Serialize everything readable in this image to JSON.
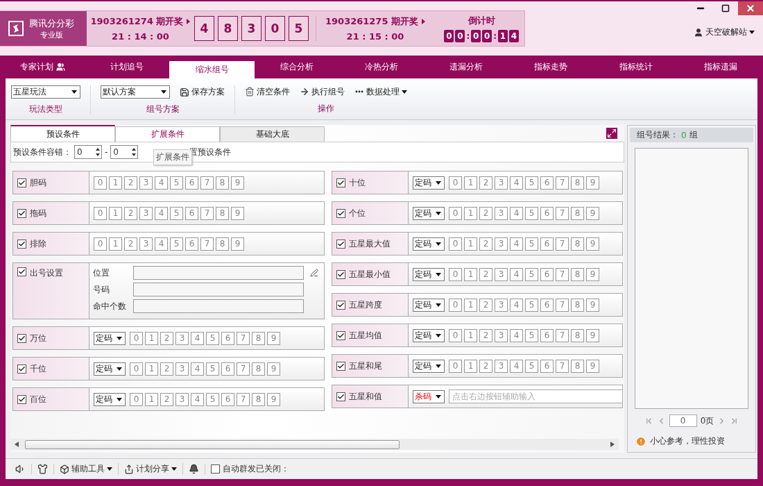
{
  "header": {
    "logo": {
      "name": "腾讯分分彩",
      "edition": "专业版"
    },
    "current": {
      "issue": "1903261274 期开奖",
      "time": "21 : 14 : 00"
    },
    "balls": [
      "4",
      "8",
      "3",
      "0",
      "5"
    ],
    "next": {
      "issue": "1903261275 期开奖",
      "time": "21 : 15 : 00"
    },
    "countdown": {
      "label": "倒计时",
      "groups": [
        [
          "0",
          "0"
        ],
        [
          "0",
          "0"
        ],
        [
          "1",
          "4"
        ]
      ],
      "separator": ":"
    },
    "user": "天空破解站"
  },
  "nav": [
    {
      "label": "专家计划",
      "kind": "icon",
      "selected": false
    },
    {
      "label": "计划追号",
      "kind": "plain",
      "selected": false
    },
    {
      "label": "缩水组号",
      "kind": "plain",
      "selected": true
    },
    {
      "label": "综合分析",
      "kind": "plain",
      "selected": false
    },
    {
      "label": "冷热分析",
      "kind": "plain",
      "selected": false
    },
    {
      "label": "遗漏分析",
      "kind": "plain",
      "selected": false
    },
    {
      "label": "指标走势",
      "kind": "plain",
      "selected": false
    },
    {
      "label": "指标统计",
      "kind": "plain",
      "selected": false
    },
    {
      "label": "指标遗漏",
      "kind": "plain",
      "selected": false
    }
  ],
  "toolbar": [
    {
      "label": "玩法类型",
      "items": [
        {
          "kind": "select",
          "label": "五星玩法"
        }
      ]
    },
    {
      "label": "组号方案",
      "items": [
        {
          "kind": "select",
          "label": "默认方案"
        },
        {
          "kind": "save",
          "label": "保存方案"
        }
      ]
    },
    {
      "label": "操作",
      "items": [
        {
          "kind": "clear",
          "label": "清空条件"
        },
        {
          "kind": "run",
          "label": "执行组号"
        },
        {
          "kind": "menu",
          "label": "数据处理"
        }
      ]
    }
  ],
  "subtabs": [
    {
      "label": "预设条件",
      "selected": true,
      "hovered": false
    },
    {
      "label": "扩展条件",
      "selected": false,
      "hovered": true
    },
    {
      "label": "基础大底",
      "selected": false,
      "hovered": false
    }
  ],
  "tolerance": {
    "label": "预设条件容错：",
    "from": "0",
    "separator": "-",
    "to": "0",
    "tooltip": "扩展条件",
    "reset": "置预设条件"
  },
  "left_conditions": [
    {
      "kind": "digits",
      "label": "胆码",
      "checked": true,
      "digits": [
        {
          "d": "0",
          "selected": false
        },
        {
          "d": "1",
          "selected": false
        },
        {
          "d": "2",
          "selected": false
        },
        {
          "d": "3",
          "selected": false
        },
        {
          "d": "4",
          "selected": false
        },
        {
          "d": "5",
          "selected": false
        },
        {
          "d": "6",
          "selected": false
        },
        {
          "d": "7",
          "selected": false
        },
        {
          "d": "8",
          "selected": false
        },
        {
          "d": "9",
          "selected": false
        }
      ]
    },
    {
      "kind": "digits",
      "label": "拖码",
      "checked": true,
      "digits": [
        {
          "d": "0",
          "selected": false
        },
        {
          "d": "1",
          "selected": false
        },
        {
          "d": "2",
          "selected": false
        },
        {
          "d": "3",
          "selected": false
        },
        {
          "d": "4",
          "selected": false
        },
        {
          "d": "5",
          "selected": false
        },
        {
          "d": "6",
          "selected": false
        },
        {
          "d": "7",
          "selected": false
        },
        {
          "d": "8",
          "selected": false
        },
        {
          "d": "9",
          "selected": false
        }
      ]
    },
    {
      "kind": "digits",
      "label": "排除",
      "checked": true,
      "digits": [
        {
          "d": "0",
          "selected": false
        },
        {
          "d": "1",
          "selected": false
        },
        {
          "d": "2",
          "selected": false
        },
        {
          "d": "3",
          "selected": false
        },
        {
          "d": "4",
          "selected": false
        },
        {
          "d": "5",
          "selected": false
        },
        {
          "d": "6",
          "selected": false
        },
        {
          "d": "7",
          "selected": false
        },
        {
          "d": "8",
          "selected": false
        },
        {
          "d": "9",
          "selected": false
        }
      ]
    },
    {
      "kind": "fields",
      "label": "出号设置",
      "checked": true,
      "fields": [
        {
          "label": "位置"
        },
        {
          "label": "号码"
        },
        {
          "label": "命中个数"
        }
      ]
    },
    {
      "kind": "mode-digits",
      "label": "万位",
      "checked": true,
      "mode": "定码",
      "digits": [
        {
          "d": "0",
          "selected": false
        },
        {
          "d": "1",
          "selected": false
        },
        {
          "d": "2",
          "selected": false
        },
        {
          "d": "3",
          "selected": false
        },
        {
          "d": "4",
          "selected": false
        },
        {
          "d": "5",
          "selected": false
        },
        {
          "d": "6",
          "selected": false
        },
        {
          "d": "7",
          "selected": false
        },
        {
          "d": "8",
          "selected": false
        },
        {
          "d": "9",
          "selected": false
        }
      ]
    },
    {
      "kind": "mode-digits",
      "label": "千位",
      "checked": true,
      "mode": "定码",
      "digits": [
        {
          "d": "0",
          "selected": false
        },
        {
          "d": "1",
          "selected": false
        },
        {
          "d": "2",
          "selected": false
        },
        {
          "d": "3",
          "selected": false
        },
        {
          "d": "4",
          "selected": false
        },
        {
          "d": "5",
          "selected": false
        },
        {
          "d": "6",
          "selected": false
        },
        {
          "d": "7",
          "selected": false
        },
        {
          "d": "8",
          "selected": false
        },
        {
          "d": "9",
          "selected": false
        }
      ]
    },
    {
      "kind": "mode-digits",
      "label": "百位",
      "checked": true,
      "mode": "定码",
      "digits": [
        {
          "d": "0",
          "selected": false
        },
        {
          "d": "1",
          "selected": false
        },
        {
          "d": "2",
          "selected": false
        },
        {
          "d": "3",
          "selected": false
        },
        {
          "d": "4",
          "selected": false
        },
        {
          "d": "5",
          "selected": false
        },
        {
          "d": "6",
          "selected": false
        },
        {
          "d": "7",
          "selected": false
        },
        {
          "d": "8",
          "selected": false
        },
        {
          "d": "9",
          "selected": false
        }
      ]
    }
  ],
  "right_conditions": [
    {
      "kind": "mode-digits",
      "label": "十位",
      "checked": true,
      "mode": "定码",
      "digits": [
        {
          "d": "0",
          "selected": false
        },
        {
          "d": "1",
          "selected": false
        },
        {
          "d": "2",
          "selected": false
        },
        {
          "d": "3",
          "selected": false
        },
        {
          "d": "4",
          "selected": false
        },
        {
          "d": "5",
          "selected": false
        },
        {
          "d": "6",
          "selected": false
        },
        {
          "d": "7",
          "selected": false
        },
        {
          "d": "8",
          "selected": false
        },
        {
          "d": "9",
          "selected": false
        }
      ]
    },
    {
      "kind": "mode-digits",
      "label": "个位",
      "checked": true,
      "mode": "定码",
      "digits": [
        {
          "d": "0",
          "selected": false
        },
        {
          "d": "1",
          "selected": false
        },
        {
          "d": "2",
          "selected": false
        },
        {
          "d": "3",
          "selected": false
        },
        {
          "d": "4",
          "selected": false
        },
        {
          "d": "5",
          "selected": false
        },
        {
          "d": "6",
          "selected": false
        },
        {
          "d": "7",
          "selected": false
        },
        {
          "d": "8",
          "selected": false
        },
        {
          "d": "9",
          "selected": false
        }
      ]
    },
    {
      "kind": "mode-digits",
      "label": "五星最大值",
      "checked": true,
      "mode": "定码",
      "digits": [
        {
          "d": "0",
          "selected": false
        },
        {
          "d": "1",
          "selected": false
        },
        {
          "d": "2",
          "selected": false
        },
        {
          "d": "3",
          "selected": false
        },
        {
          "d": "4",
          "selected": false
        },
        {
          "d": "5",
          "selected": false
        },
        {
          "d": "6",
          "selected": false
        },
        {
          "d": "7",
          "selected": false
        },
        {
          "d": "8",
          "selected": false
        },
        {
          "d": "9",
          "selected": false
        }
      ]
    },
    {
      "kind": "mode-digits",
      "label": "五星最小值",
      "checked": true,
      "mode": "定码",
      "digits": [
        {
          "d": "0",
          "selected": false
        },
        {
          "d": "1",
          "selected": false
        },
        {
          "d": "2",
          "selected": false
        },
        {
          "d": "3",
          "selected": false
        },
        {
          "d": "4",
          "selected": false
        },
        {
          "d": "5",
          "selected": false
        },
        {
          "d": "6",
          "selected": false
        },
        {
          "d": "7",
          "selected": false
        },
        {
          "d": "8",
          "selected": false
        },
        {
          "d": "9",
          "selected": false
        }
      ]
    },
    {
      "kind": "mode-digits",
      "label": "五星跨度",
      "checked": true,
      "mode": "定码",
      "digits": [
        {
          "d": "0",
          "selected": false
        },
        {
          "d": "1",
          "selected": false
        },
        {
          "d": "2",
          "selected": false
        },
        {
          "d": "3",
          "selected": false
        },
        {
          "d": "4",
          "selected": false
        },
        {
          "d": "5",
          "selected": false
        },
        {
          "d": "6",
          "selected": false
        },
        {
          "d": "7",
          "selected": false
        },
        {
          "d": "8",
          "selected": false
        },
        {
          "d": "9",
          "selected": false
        }
      ]
    },
    {
      "kind": "mode-digits",
      "label": "五星均值",
      "checked": true,
      "mode": "定码",
      "digits": [
        {
          "d": "0",
          "selected": false
        },
        {
          "d": "1",
          "selected": false
        },
        {
          "d": "2",
          "selected": false
        },
        {
          "d": "3",
          "selected": false
        },
        {
          "d": "4",
          "selected": false
        },
        {
          "d": "5",
          "selected": false
        },
        {
          "d": "6",
          "selected": false
        },
        {
          "d": "7",
          "selected": false
        },
        {
          "d": "8",
          "selected": false
        },
        {
          "d": "9",
          "selected": false
        }
      ]
    },
    {
      "kind": "mode-digits",
      "label": "五星和尾",
      "checked": true,
      "mode": "定码",
      "digits": [
        {
          "d": "0",
          "selected": false
        },
        {
          "d": "1",
          "selected": false
        },
        {
          "d": "2",
          "selected": false
        },
        {
          "d": "3",
          "selected": false
        },
        {
          "d": "4",
          "selected": false
        },
        {
          "d": "5",
          "selected": false
        },
        {
          "d": "6",
          "selected": false
        },
        {
          "d": "7",
          "selected": false
        },
        {
          "d": "8",
          "selected": false
        },
        {
          "d": "9",
          "selected": false
        }
      ]
    },
    {
      "kind": "mode-input",
      "label": "五星和值",
      "checked": true,
      "mode": "杀码",
      "mode_alert": true,
      "placeholder": "点击右边按钮辅助输入"
    }
  ],
  "result": {
    "label": "组号结果：",
    "count": "0",
    "unit": "组",
    "page": "0",
    "pages": "0页",
    "notice": "小心参考，理性投资"
  },
  "status_bar": [
    {
      "kind": "sound"
    },
    {
      "kind": "skin"
    },
    {
      "kind": "tools",
      "label": "辅助工具"
    },
    {
      "kind": "share",
      "label": "计划分享"
    },
    {
      "kind": "bell"
    },
    {
      "kind": "checkbox",
      "label": "自动群发已关闭：",
      "checked": false
    }
  ]
}
